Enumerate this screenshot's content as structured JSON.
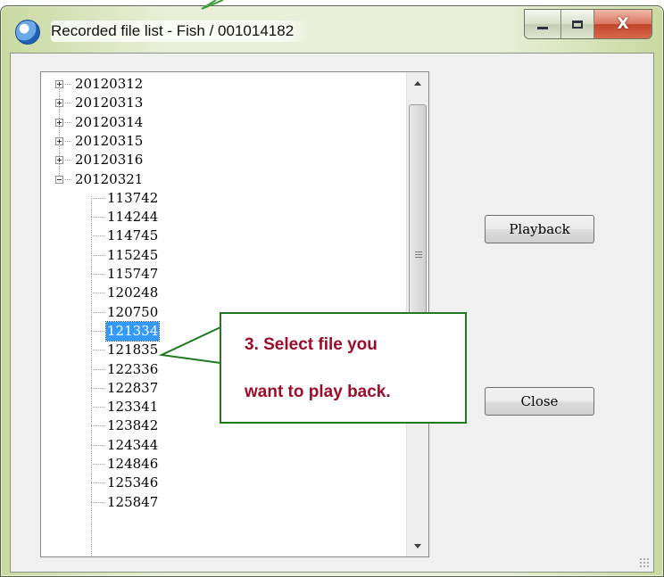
{
  "window": {
    "title": "Recorded file list - Fish / 001014182",
    "icon": "app-globe-icon",
    "caption_buttons": {
      "min_icon": "minimize-icon",
      "max_icon": "maximize-icon",
      "close_glyph": "X"
    }
  },
  "tree": {
    "dates": [
      "20120312",
      "20120313",
      "20120314",
      "20120315",
      "20120316",
      "20120321"
    ],
    "expanded_date": "20120321",
    "files": [
      "113742",
      "114244",
      "114745",
      "115245",
      "115747",
      "120248",
      "120750",
      "121334",
      "121835",
      "122336",
      "122837",
      "123341",
      "123842",
      "124344",
      "124846",
      "125346",
      "125847"
    ],
    "selected_file": "121334"
  },
  "buttons": {
    "playback": "Playback",
    "close": "Close"
  },
  "callout": {
    "line1": "3. Select file you",
    "line2": "want to play back.",
    "border_color": "#1f7a1f",
    "text_color": "#9c0d2a"
  },
  "colors": {
    "selection": "#3399ff",
    "frame": "#e9efd8"
  }
}
